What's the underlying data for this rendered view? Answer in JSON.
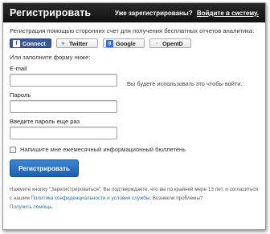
{
  "header": {
    "title": "Регистрировать",
    "already_registered": "Уже зарегистрированы?",
    "login_link": "Войдите в систему."
  },
  "intro": "Регистрация помощью сторонних счет для получения бесплатных отчетов аналитика:",
  "social": {
    "facebook": "Connect",
    "twitter": "Twitter",
    "google": "Google",
    "openid": "OpenID"
  },
  "or_fill": "Или заполните форму ниже:",
  "form": {
    "email_label": "E-mail",
    "email_value": "",
    "email_hint": "Вы будете использовать это чтобы войти.",
    "password_label": "Пароль",
    "password_value": "",
    "password2_label": "Введите пароль еще раз",
    "password2_value": "",
    "newsletter_label": "Напишите мне ежемесячный информационный бюллетень",
    "submit_label": "Регистрировать"
  },
  "terms": {
    "part1": "Нажмите кнопку \"Зарегистрироваться\", Вы подтверждаете, что вы по крайней мере 13 лет, и согласиться с нашим ",
    "privacy_link": "Политика конфиденциальности",
    "and": " и ",
    "tos_link": "условия службы",
    "part2": ". Возникли проблемы?",
    "help_link": "Получить помощь",
    "end": "."
  }
}
